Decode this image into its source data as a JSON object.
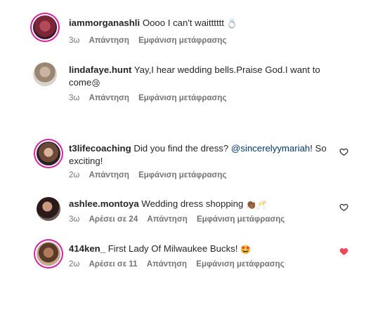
{
  "comments": [
    {
      "username": "iammorganashli",
      "text": "Oooo I can't waitttttt",
      "emoji": "💍",
      "time": "3ω",
      "likes": "",
      "reply": "Απάντηση",
      "translate": "Εμφάνιση μετάφρασης",
      "liked": false
    },
    {
      "username": "lindafaye.hunt",
      "text": "Yay,I hear wedding bells.Praise God.I want to come",
      "emoji": "😢",
      "time": "3ω",
      "likes": "",
      "reply": "Απάντηση",
      "translate": "Εμφάνιση μετάφρασης",
      "liked": false
    },
    {
      "username": "t3lifecoaching",
      "text_before": "Did you find the dress?",
      "mention": "@sincerelyymariah",
      "text_after": "! So exciting!",
      "time": "2ω",
      "likes": "",
      "reply": "Απάντηση",
      "translate": "Εμφάνιση μετάφρασης",
      "liked": false
    },
    {
      "username": "ashlee.montoya",
      "text": "Wedding dress shopping",
      "emoji": "👏🏾🥂",
      "time": "3ω",
      "likes": "Αρέσει σε 24",
      "reply": "Απάντηση",
      "translate": "Εμφάνιση μετάφρασης",
      "liked": false
    },
    {
      "username": "414ken_",
      "text": "First Lady Of Milwaukee Bucks!",
      "emoji": "🤩",
      "time": "2ω",
      "likes": "Αρέσει σε 11",
      "reply": "Απάντηση",
      "translate": "Εμφάνιση μετάφρασης",
      "liked": true
    }
  ],
  "colors": {
    "like_heart": "#ed4956",
    "meta_text": "#737373",
    "mention": "#00376b",
    "story_ring": "#d6249f"
  }
}
